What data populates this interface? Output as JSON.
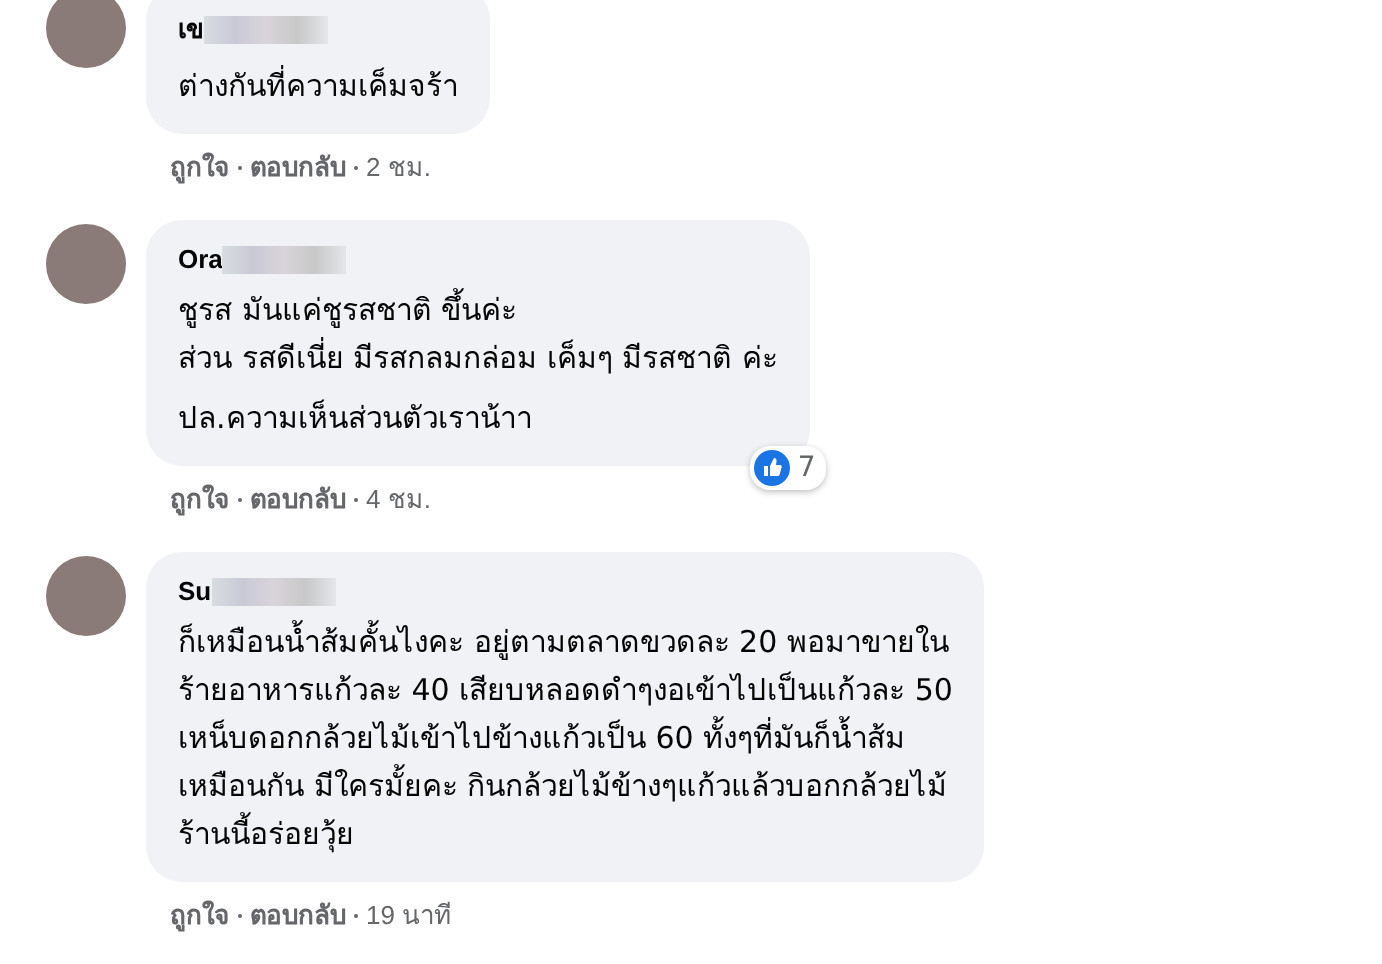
{
  "comments": [
    {
      "author": "เข",
      "paragraphs": [
        "ต่างกันที่ความเค็มจร้า"
      ],
      "actions": [
        "ถูกใจ",
        "ตอบกลับ"
      ],
      "time": "2 ชม."
    },
    {
      "author": "Ora",
      "paragraphs": [
        "ชูรส มันแค่ชูรสชาติ ขึ้นค่ะ\nส่วน รสดีเนี่ย มีรสกลมกล่อม เค็มๆ มีรสชาติ ค่ะ",
        "ปล.ความเห็นส่วนตัวเราน้าา"
      ],
      "reactions": {
        "count": "7"
      },
      "actions": [
        "ถูกใจ",
        "ตอบกลับ"
      ],
      "time": "4 ชม."
    },
    {
      "author": "Su",
      "paragraphs": [
        "ก็เหมือนน้ำส้มคั้นไงคะ อยู่ตามตลาดขวดละ 20 พอมาขายใน\nร้ายอาหารแก้วละ 40 เสียบหลอดดำๆงอเข้าไปเป็นแก้วละ 50\nเหน็บดอกกล้วยไม้เข้าไปข้างแก้วเป็น 60 ทั้งๆที่มันก็น้ำส้ม\nเหมือนกัน มีใครมั้ยคะ กินกล้วยไม้ข้างๆแก้วแล้วบอกกล้วยไม้\nร้านนี้อร่อยวุ้ย"
      ],
      "actions": [
        "ถูกใจ",
        "ตอบกลับ"
      ],
      "time": "19 นาที"
    }
  ]
}
